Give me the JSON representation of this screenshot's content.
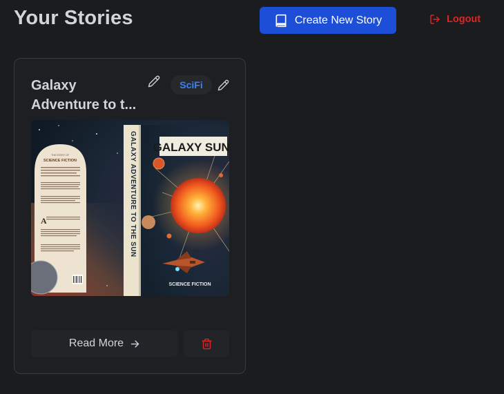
{
  "header": {
    "title": "Your Stories",
    "create_label": "Create New Story",
    "logout_label": "Logout"
  },
  "story": {
    "title_line1": "Galaxy",
    "title_line2": "Adventure to t...",
    "genre": "SciFi",
    "read_more_label": "Read More",
    "cover": {
      "spine_title": "GALAXY ADVENTURE TO THE SUN",
      "front_title": "GALAXY SUN!",
      "front_footer": "SCIENCE FICTION",
      "back_heading_small": "THE STORY OF",
      "back_heading": "SCIENCE FICTION",
      "drop_cap": "A"
    }
  },
  "colors": {
    "background": "#1b1c1e",
    "primary": "#1d4ed8",
    "danger": "#dc2626",
    "badge_text": "#3b82f6"
  },
  "icons": {
    "create": "book-icon",
    "logout": "logout-icon",
    "edit": "pencil-icon",
    "read_more": "arrow-right-icon",
    "delete": "trash-icon"
  }
}
